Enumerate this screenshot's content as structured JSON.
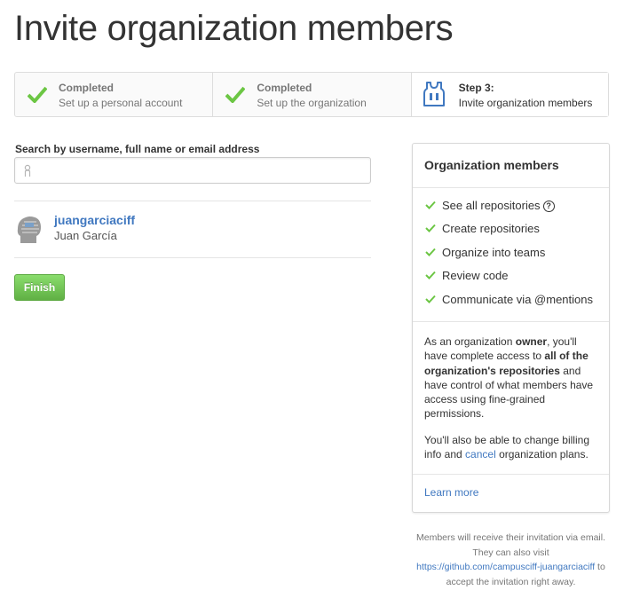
{
  "page": {
    "title": "Invite organization members"
  },
  "steps": [
    {
      "title": "Completed",
      "description": "Set up a personal account",
      "icon": "check-icon",
      "state": "completed"
    },
    {
      "title": "Completed",
      "description": "Set up the organization",
      "icon": "check-icon",
      "state": "completed"
    },
    {
      "title": "Step 3:",
      "description": "Invite organization members",
      "icon": "jersey-icon",
      "state": "active"
    }
  ],
  "search": {
    "label": "Search by username, full name or email address",
    "value": "",
    "placeholder": ""
  },
  "members": [
    {
      "login": "juangarciaciff",
      "name": "Juan García"
    }
  ],
  "finish_label": "Finish",
  "panel": {
    "title": "Organization members",
    "permissions": [
      "See all repositories",
      "Create repositories",
      "Organize into teams",
      "Review code",
      "Communicate via @mentions"
    ],
    "owner_text": {
      "p1": "As an organization ",
      "owner": "owner",
      "p2": ", you'll have complete access to ",
      "all_repos": "all of the organization's repositories",
      "p3": " and have control of what members have access using fine-grained permissions."
    },
    "billing_text": {
      "p1": "You'll also be able to change billing info and ",
      "cancel": "cancel",
      "p2": " organization plans."
    },
    "learn_more": "Learn more"
  },
  "footnote": {
    "p1": "Members will receive their invitation via email. They can also visit ",
    "url": "https://github.com/campusciff-juangarciaciff",
    "p2": " to accept the invitation right away."
  },
  "colors": {
    "check": "#6cc644",
    "link": "#4078c0",
    "finish": "#60b044"
  }
}
